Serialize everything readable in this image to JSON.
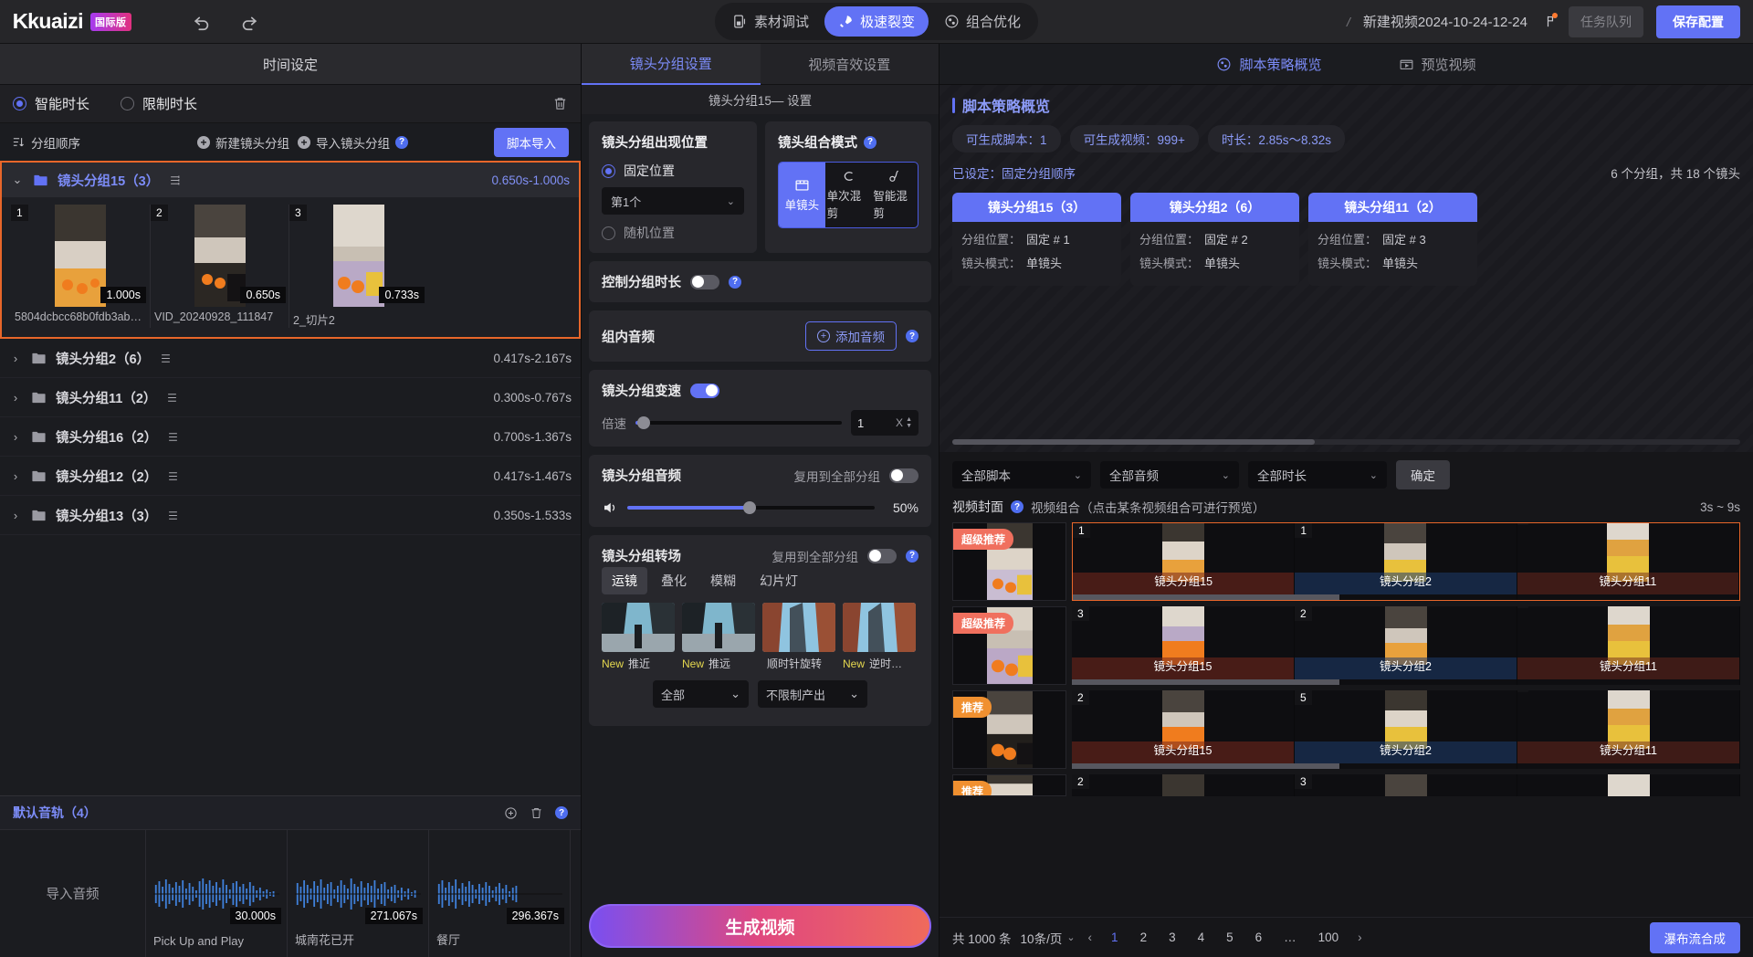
{
  "header": {
    "logo_text": "kuaizi",
    "logo_badge": "国际版",
    "undo_icon": "undo-icon",
    "redo_icon": "redo-icon",
    "modes": [
      {
        "label": "素材调试",
        "icon": "material-debug-icon",
        "active": false
      },
      {
        "label": "极速裂变",
        "icon": "rocket-icon",
        "active": true
      },
      {
        "label": "组合优化",
        "icon": "combination-icon",
        "active": false
      }
    ],
    "separator": "/",
    "project_name": "新建视频2024-10-24-12-24",
    "flag_icon": "flag-icon",
    "task_queue_label": "任务队列",
    "save_label": "保存配置"
  },
  "left": {
    "tab_title": "时间设定",
    "duration_modes": [
      {
        "label": "智能时长",
        "selected": true
      },
      {
        "label": "限制时长",
        "selected": false
      }
    ],
    "delete_icon": "trash-icon",
    "toolbar": {
      "sort_label": "分组顺序",
      "sort_icon": "sort-icon",
      "new_group_label": "新建镜头分组",
      "import_group_label": "导入镜头分组",
      "help_icon": "help-icon",
      "script_import_label": "脚本导入"
    },
    "groups": [
      {
        "name": "镜头分组15（3）",
        "range": "0.650s-1.000s",
        "expanded": true,
        "clips": [
          {
            "num": "1",
            "duration": "1.000s",
            "name": "5804dcbcc68b0fdb3ab…"
          },
          {
            "num": "2",
            "duration": "0.650s",
            "name": "VID_20240928_111847"
          },
          {
            "num": "3",
            "duration": "0.733s",
            "name": "2_切片2"
          }
        ]
      },
      {
        "name": "镜头分组2（6）",
        "range": "0.417s-2.167s",
        "expanded": false,
        "clips": []
      },
      {
        "name": "镜头分组11（2）",
        "range": "0.300s-0.767s",
        "expanded": false,
        "clips": []
      },
      {
        "name": "镜头分组16（2）",
        "range": "0.700s-1.367s",
        "expanded": false,
        "clips": []
      },
      {
        "name": "镜头分组12（2）",
        "range": "0.417s-1.467s",
        "expanded": false,
        "clips": []
      },
      {
        "name": "镜头分组13（3）",
        "range": "0.350s-1.533s",
        "expanded": false,
        "clips": []
      }
    ],
    "audio": {
      "title": "默认音轨（4）",
      "add_icon": "add-icon",
      "delete_icon": "trash-icon",
      "help_icon": "help-icon",
      "import_label": "导入音频",
      "tracks": [
        {
          "duration": "30.000s",
          "name": "Pick Up and Play"
        },
        {
          "duration": "271.067s",
          "name": "城南花已开"
        },
        {
          "duration": "296.367s",
          "name": "餐厅"
        }
      ]
    }
  },
  "center": {
    "tabs": [
      {
        "label": "镜头分组设置",
        "active": true
      },
      {
        "label": "视频音效设置",
        "active": false
      }
    ],
    "subhead": "镜头分组15— 设置",
    "position": {
      "title": "镜头分组出现位置",
      "fixed_label": "固定位置",
      "fixed_selected": true,
      "select_value": "第1个",
      "random_label": "随机位置",
      "random_selected": false
    },
    "combo_mode": {
      "title": "镜头组合模式",
      "help_icon": "help-icon",
      "options": [
        {
          "label": "单镜头",
          "icon": "single-lens-icon",
          "active": true
        },
        {
          "label": "单次混剪",
          "icon": "single-mix-icon",
          "active": false
        },
        {
          "label": "智能混剪",
          "icon": "smart-mix-icon",
          "active": false
        }
      ]
    },
    "control_duration": {
      "label": "控制分组时长",
      "enabled": false,
      "help_icon": "help-icon"
    },
    "group_audio": {
      "label": "组内音频",
      "add_label": "添加音频",
      "help_icon": "help-icon"
    },
    "speed": {
      "label": "镜头分组变速",
      "enabled": true,
      "slider_label": "倍速",
      "value": "1",
      "unit": "X",
      "percent": 3
    },
    "audio_section": {
      "label": "镜头分组音频",
      "reuse_label": "复用到全部分组",
      "reuse_enabled": false,
      "volume_icon": "volume-icon",
      "volume_text": "50%",
      "volume_percent": 50
    },
    "transition": {
      "label": "镜头分组转场",
      "reuse_label": "复用到全部分组",
      "reuse_enabled": false,
      "help_icon": "help-icon",
      "tabs": [
        {
          "label": "运镜",
          "active": true
        },
        {
          "label": "叠化",
          "active": false
        },
        {
          "label": "模糊",
          "active": false
        },
        {
          "label": "幻片灯",
          "active": false
        }
      ],
      "items": [
        {
          "tag": "New",
          "label": "推近"
        },
        {
          "tag": "New",
          "label": "推远"
        },
        {
          "tag": "",
          "label": "顺时针旋转"
        },
        {
          "tag": "New",
          "label": "逆时…"
        }
      ],
      "filters": [
        {
          "value": "全部"
        },
        {
          "value": "不限制产出"
        }
      ]
    },
    "generate_label": "生成视频"
  },
  "right": {
    "tabs": [
      {
        "label": "脚本策略概览",
        "icon": "strategy-icon",
        "active": true
      },
      {
        "label": "预览视频",
        "icon": "preview-icon",
        "active": false
      }
    ],
    "strategy": {
      "title": "脚本策略概览",
      "pills": [
        "可生成脚本：1",
        "可生成视频：999+",
        "时长：2.85s～8.32s"
      ],
      "setting_left": "已设定：固定分组顺序",
      "setting_right": "6 个分组，共 18 个镜头",
      "cards": [
        {
          "title": "镜头分组15（3）",
          "pos_label": "分组位置：",
          "pos_value": "固定 # 1",
          "mode_label": "镜头模式：",
          "mode_value": "单镜头"
        },
        {
          "title": "镜头分组2（6）",
          "pos_label": "分组位置：",
          "pos_value": "固定 # 2",
          "mode_label": "镜头模式：",
          "mode_value": "单镜头"
        },
        {
          "title": "镜头分组11（2）",
          "pos_label": "分组位置：",
          "pos_value": "固定 # 3",
          "mode_label": "镜头模式：",
          "mode_value": "单镜头"
        }
      ]
    },
    "filters": [
      {
        "value": "全部脚本"
      },
      {
        "value": "全部音频"
      },
      {
        "value": "全部时长"
      }
    ],
    "confirm_label": "确定",
    "combo_header": {
      "cover_label": "视频封面",
      "help_icon": "help-icon",
      "combo_label": "视频组合（点击某条视频组合可进行预览）",
      "duration_range": "3s ~ 9s"
    },
    "combos": [
      {
        "badge": "超级推荐",
        "badge_type": "super",
        "selected": true,
        "cells": [
          {
            "num": "1",
            "label": "镜头分组15"
          },
          {
            "num": "1",
            "label": "镜头分组2"
          },
          {
            "num": "",
            "label": "镜头分组11"
          }
        ]
      },
      {
        "badge": "超级推荐",
        "badge_type": "super",
        "selected": false,
        "cells": [
          {
            "num": "3",
            "label": "镜头分组15"
          },
          {
            "num": "2",
            "label": "镜头分组2"
          },
          {
            "num": "",
            "label": "镜头分组11"
          }
        ]
      },
      {
        "badge": "推荐",
        "badge_type": "rec",
        "selected": false,
        "cells": [
          {
            "num": "2",
            "label": "镜头分组15"
          },
          {
            "num": "5",
            "label": "镜头分组2"
          },
          {
            "num": "",
            "label": "镜头分组11"
          }
        ]
      },
      {
        "badge": "推荐",
        "badge_type": "rec",
        "selected": false,
        "cells": [
          {
            "num": "2",
            "label": ""
          },
          {
            "num": "3",
            "label": ""
          },
          {
            "num": "",
            "label": ""
          }
        ]
      }
    ],
    "pager": {
      "total_label": "共 1000 条",
      "per_page": "10条/页",
      "prev_icon": "chevron-left-icon",
      "next_icon": "chevron-right-icon",
      "pages": [
        "1",
        "2",
        "3",
        "4",
        "5",
        "6",
        "…",
        "100"
      ],
      "current": "1",
      "waterfall_label": "瀑布流合成"
    }
  },
  "colors": {
    "accent": "#6272f5",
    "selection": "#e8662a",
    "badge_super": "#f0705e",
    "badge_rec": "#f09030"
  }
}
